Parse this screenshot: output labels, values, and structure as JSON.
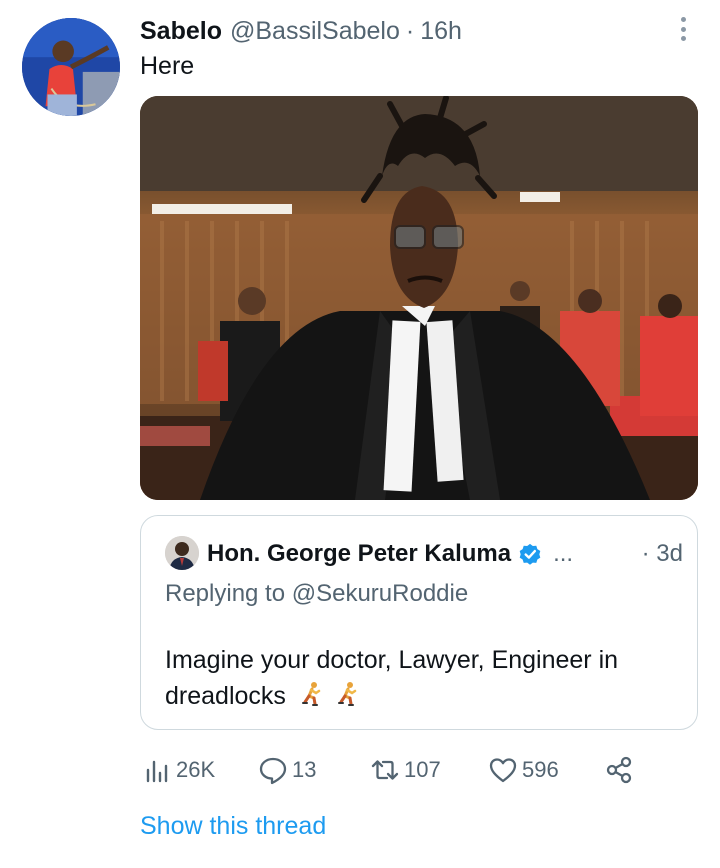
{
  "tweet": {
    "display_name": "Sabelo",
    "handle": "@BassilSabelo",
    "separator": "·",
    "time": "16h",
    "text": "Here"
  },
  "quote": {
    "display_name": "Hon. George Peter Kaluma",
    "verified_icon": "verified-badge-icon",
    "ellipsis": "...",
    "separator": "·",
    "time": "3d",
    "replying_to": "Replying to @SekuruRoddie",
    "text": "Imagine your doctor, Lawyer, Engineer in dreadlocks",
    "emoji": "person-running-icon"
  },
  "actions": {
    "views": "26K",
    "replies": "13",
    "retweets": "107",
    "likes": "596"
  },
  "show_thread": "Show this thread",
  "colors": {
    "accent": "#1d9bf0",
    "secondary_text": "#536471",
    "border": "#cfd9de"
  }
}
